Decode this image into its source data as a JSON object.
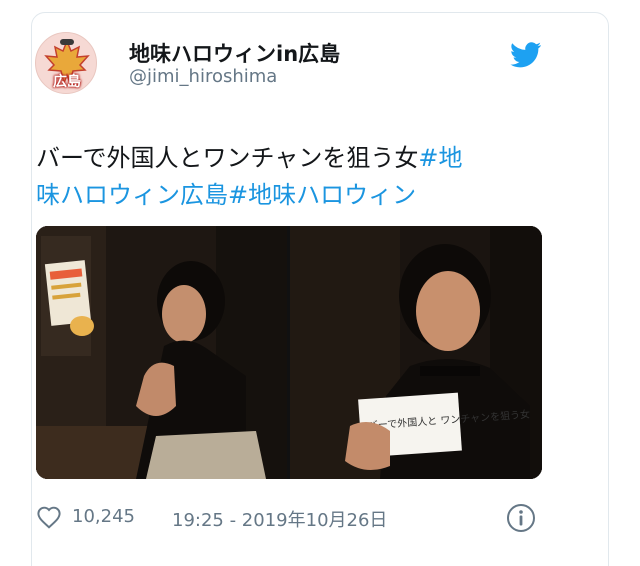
{
  "tweet": {
    "display_name": "地味ハロウィンin広島",
    "handle": "@jimi_hiroshima",
    "avatar_text": "広島",
    "text_plain": "バーで外国人とワンチャンを狙う女",
    "hashtag_1a": "#地",
    "hashtag_1b": "味ハロウィン広島",
    "hashtag_2": "#地味ハロウィン",
    "photo_2_sign": "バーで外国人と ワンチャンを狙う女",
    "like_count": "10,245",
    "timestamp": "19:25 - 2019年10月26日"
  },
  "icons": {
    "brand": "twitter-bird-icon",
    "like": "heart-icon",
    "info": "info-icon"
  },
  "colors": {
    "link": "#1b95e0",
    "brand": "#1da1f2",
    "muted": "#657786"
  }
}
